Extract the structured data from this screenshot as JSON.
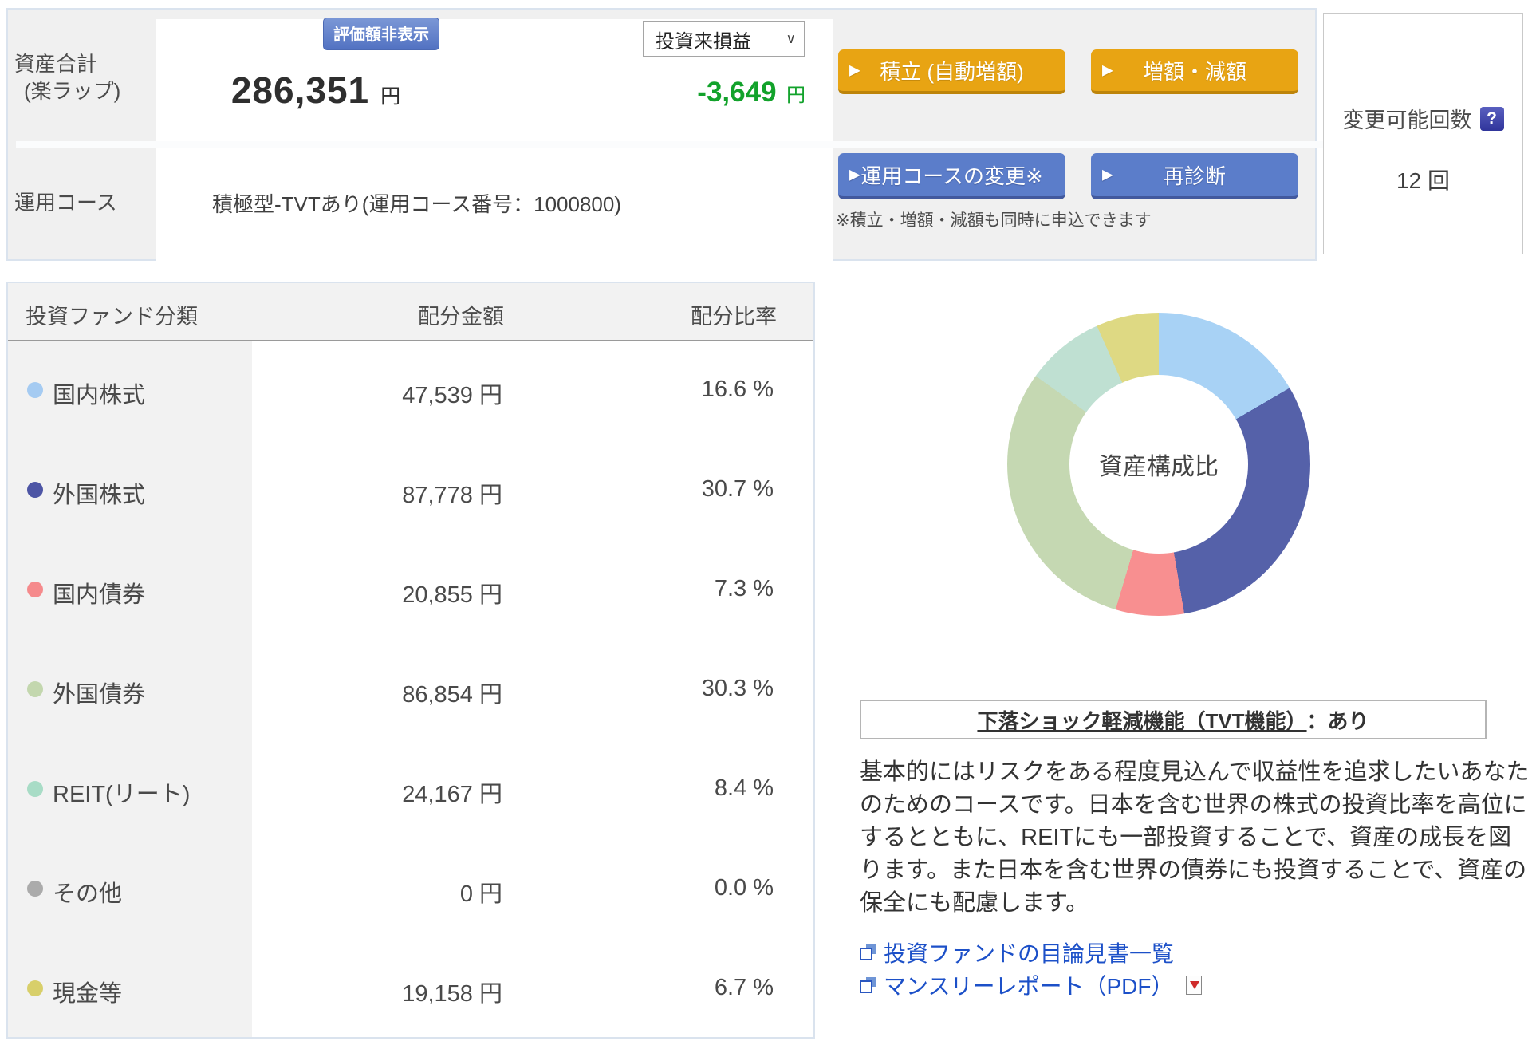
{
  "top_panel": {
    "assets_label_line1": "資産合計",
    "assets_label_line2": "(楽ラップ)",
    "hide_value_badge": "評価額非表示",
    "total_value": "286,351",
    "total_unit": "円",
    "pl_select_value": "投資来損益",
    "pl_select_chevron": "∨",
    "pl_value": "-3,649",
    "pl_unit": "円",
    "course_label": "運用コース",
    "course_value": "積極型-TVTあり(運用コース番号：1000800)",
    "buttons": {
      "tsumitate": "積立 (自動増額)",
      "zougaku": "増額・減額",
      "course_change": "運用コースの変更※",
      "rediagnosis": "再診断"
    },
    "note": "※積立・増額・減額も同時に申込できます",
    "change_count": {
      "label": "変更可能回数",
      "help_icon": "?",
      "value": "12 回"
    }
  },
  "allocation_table": {
    "headers": [
      "投資ファンド分類",
      "配分金額",
      "配分比率"
    ],
    "rows": [
      {
        "label": "国内株式",
        "color": "#a5cbf2",
        "amount": "47,539 円",
        "ratio": "16.6 %"
      },
      {
        "label": "外国株式",
        "color": "#4d55a5",
        "amount": "87,778 円",
        "ratio": "30.7 %"
      },
      {
        "label": "国内債券",
        "color": "#f58a8c",
        "amount": "20,855 円",
        "ratio": "7.3 %"
      },
      {
        "label": "外国債券",
        "color": "#c3d7ae",
        "amount": "86,854 円",
        "ratio": "30.3 %"
      },
      {
        "label": "REIT(リート)",
        "color": "#a8dcc6",
        "amount": "24,167 円",
        "ratio": "8.4 %"
      },
      {
        "label": "その他",
        "color": "#ababab",
        "amount": "0 円",
        "ratio": "0.0 %"
      },
      {
        "label": "現金等",
        "color": "#d8cf6a",
        "amount": "19,158 円",
        "ratio": "6.7 %"
      }
    ]
  },
  "chart_data": {
    "type": "pie",
    "subtype": "donut",
    "title": "資産構成比",
    "labels": [
      "国内株式",
      "外国株式",
      "国内債券",
      "外国債券",
      "REIT(リート)",
      "その他",
      "現金等"
    ],
    "values": [
      16.6,
      30.7,
      7.3,
      30.3,
      8.4,
      0.0,
      6.7
    ],
    "unit": "%",
    "colors": [
      "#a8d2f5",
      "#5561a9",
      "#f88f90",
      "#c5d8b2",
      "#bfe0d2",
      "#ababab",
      "#ded983"
    ],
    "start_angle_deg": 0,
    "direction": "clockwise",
    "center_label": "資産構成比"
  },
  "tvt_box": {
    "label": "下落ショック軽減機能（TVT機能）",
    "value": "：あり"
  },
  "description": "基本的にはリスクをある程度見込んで収益性を追求したいあなたのためのコースです。日本を含む世界の株式の投資比率を高位にするとともに、REITにも一部投資することで、資産の成長を図ります。また日本を含む世界の債券にも投資することで、資産の保全にも配慮します。",
  "links": [
    {
      "label": "投資ファンドの目論見書一覧"
    },
    {
      "label": "マンスリーレポート（PDF）"
    }
  ]
}
